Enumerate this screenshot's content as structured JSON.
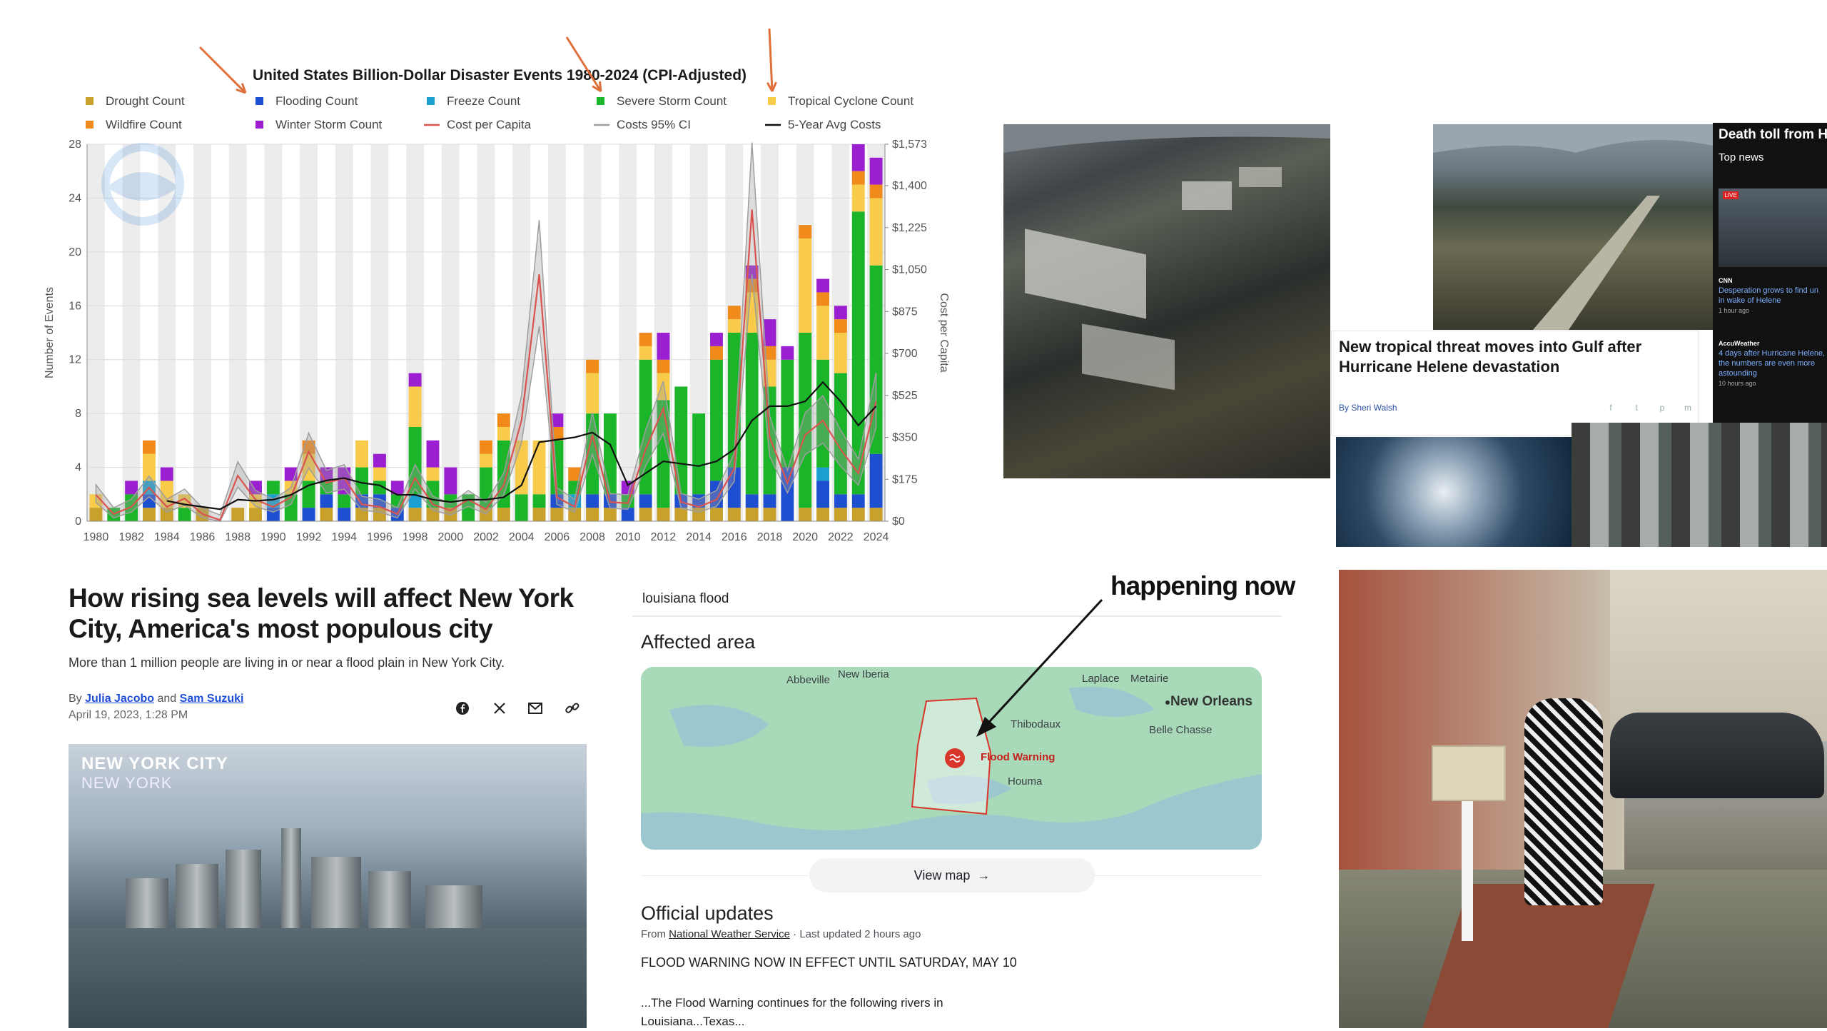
{
  "chart_data": {
    "type": "bar",
    "title": "United States Billion-Dollar Disaster Events 1980-2024 (CPI-Adjusted)",
    "ylabel": "Number of Events",
    "y2label": "Cost per Capita",
    "ylim": [
      0,
      28
    ],
    "y2lim": [
      0,
      1573
    ],
    "yticks": [
      "0",
      "4",
      "8",
      "12",
      "16",
      "20",
      "24",
      "28"
    ],
    "y2ticks": [
      "$0",
      "$175",
      "$350",
      "$525",
      "$700",
      "$875",
      "$1,050",
      "$1,225",
      "$1,400",
      "$1,573"
    ],
    "xticks": [
      "1980",
      "1982",
      "1984",
      "1986",
      "1988",
      "1990",
      "1992",
      "1994",
      "1996",
      "1998",
      "2000",
      "2002",
      "2004",
      "2006",
      "2008",
      "2010",
      "2012",
      "2014",
      "2016",
      "2018",
      "2020",
      "2022",
      "2024"
    ],
    "legend": [
      "Drought Count",
      "Flooding Count",
      "Freeze Count",
      "Severe Storm Count",
      "Tropical Cyclone Count",
      "Wildfire Count",
      "Winter Storm Count",
      "Cost per Capita",
      "Costs 95% CI",
      "5-Year Avg Costs"
    ],
    "grid": true,
    "x": [
      1980,
      1981,
      1982,
      1983,
      1984,
      1985,
      1986,
      1987,
      1988,
      1989,
      1990,
      1991,
      1992,
      1993,
      1994,
      1995,
      1996,
      1997,
      1998,
      1999,
      2000,
      2001,
      2002,
      2003,
      2004,
      2005,
      2006,
      2007,
      2008,
      2009,
      2010,
      2011,
      2012,
      2013,
      2014,
      2015,
      2016,
      2017,
      2018,
      2019,
      2020,
      2021,
      2022,
      2023,
      2024
    ],
    "series": [
      {
        "name": "Drought Count",
        "values": [
          1,
          0,
          0,
          1,
          1,
          0,
          1,
          0,
          1,
          1,
          0,
          0,
          0,
          1,
          0,
          1,
          1,
          0,
          1,
          1,
          1,
          0,
          1,
          1,
          0,
          1,
          1,
          1,
          1,
          1,
          0,
          1,
          1,
          1,
          1,
          1,
          1,
          1,
          1,
          0,
          1,
          1,
          1,
          1,
          1
        ]
      },
      {
        "name": "Flooding Count",
        "values": [
          0,
          0,
          0,
          1,
          0,
          0,
          0,
          0,
          0,
          0,
          1,
          0,
          1,
          1,
          1,
          1,
          1,
          1,
          0,
          0,
          0,
          0,
          0,
          0,
          0,
          0,
          1,
          0,
          1,
          1,
          1,
          1,
          0,
          1,
          1,
          2,
          3,
          1,
          1,
          4,
          0,
          2,
          1,
          1,
          4
        ]
      },
      {
        "name": "Freeze Count",
        "values": [
          0,
          0,
          0,
          1,
          0,
          0,
          0,
          0,
          0,
          0,
          1,
          0,
          0,
          0,
          0,
          0,
          0,
          0,
          1,
          0,
          0,
          0,
          0,
          0,
          0,
          0,
          0,
          1,
          0,
          0,
          0,
          0,
          0,
          0,
          0,
          0,
          0,
          0,
          0,
          0,
          0,
          1,
          0,
          0,
          0
        ]
      },
      {
        "name": "Severe Storm Count",
        "values": [
          0,
          1,
          2,
          0,
          0,
          1,
          0,
          0,
          0,
          0,
          1,
          2,
          2,
          1,
          1,
          2,
          1,
          1,
          5,
          2,
          1,
          2,
          3,
          5,
          2,
          1,
          4,
          1,
          6,
          6,
          1,
          10,
          8,
          8,
          6,
          9,
          10,
          12,
          8,
          8,
          13,
          8,
          9,
          21,
          14
        ]
      },
      {
        "name": "Tropical Cyclone Count",
        "values": [
          1,
          0,
          0,
          2,
          2,
          1,
          0,
          0,
          0,
          1,
          0,
          1,
          2,
          0,
          0,
          2,
          1,
          0,
          3,
          1,
          0,
          0,
          1,
          1,
          4,
          4,
          0,
          0,
          3,
          0,
          0,
          1,
          2,
          0,
          0,
          0,
          1,
          3,
          2,
          0,
          7,
          4,
          3,
          2,
          5
        ]
      },
      {
        "name": "Wildfire Count",
        "values": [
          0,
          0,
          0,
          1,
          0,
          0,
          0,
          0,
          0,
          0,
          0,
          0,
          1,
          0,
          0,
          0,
          0,
          0,
          0,
          0,
          0,
          0,
          1,
          1,
          0,
          0,
          1,
          1,
          1,
          0,
          0,
          1,
          1,
          0,
          0,
          1,
          1,
          1,
          1,
          0,
          1,
          1,
          1,
          1,
          1
        ]
      },
      {
        "name": "Winter Storm Count",
        "values": [
          0,
          0,
          1,
          0,
          1,
          0,
          0,
          0,
          0,
          1,
          0,
          1,
          0,
          1,
          2,
          0,
          1,
          1,
          1,
          2,
          2,
          0,
          0,
          0,
          0,
          0,
          1,
          0,
          0,
          0,
          1,
          0,
          2,
          0,
          0,
          1,
          0,
          1,
          2,
          1,
          0,
          1,
          1,
          2,
          2
        ]
      }
    ],
    "lines": [
      {
        "name": "Cost per Capita",
        "values": [
          110,
          30,
          60,
          140,
          60,
          95,
          30,
          5,
          190,
          90,
          60,
          100,
          290,
          160,
          180,
          70,
          60,
          30,
          180,
          70,
          45,
          90,
          50,
          150,
          420,
          1030,
          100,
          60,
          360,
          80,
          75,
          300,
          470,
          80,
          60,
          90,
          220,
          1300,
          350,
          160,
          360,
          420,
          300,
          200,
          500
        ]
      },
      {
        "name": "5-Year Avg Costs",
        "values": [
          null,
          null,
          null,
          null,
          85,
          70,
          60,
          50,
          90,
          85,
          90,
          110,
          150,
          170,
          180,
          160,
          150,
          110,
          110,
          90,
          80,
          90,
          90,
          100,
          150,
          330,
          340,
          350,
          370,
          320,
          150,
          200,
          250,
          240,
          230,
          250,
          300,
          420,
          480,
          480,
          500,
          580,
          500,
          400,
          480
        ]
      }
    ],
    "annotations": [
      "arrow-to-flooding-count",
      "arrow-to-severe-storm-count",
      "arrow-to-tropical-cyclone-count"
    ]
  },
  "news": {
    "headline": "New tropical threat moves into Gulf after Hurricane Helene devastation",
    "byline": "By Sheri Walsh",
    "share": [
      "f",
      "t",
      "p",
      "m"
    ],
    "sidebar_title": "Death toll from H",
    "sidebar_top": "Top news",
    "live_badge": "LIVE",
    "items": [
      {
        "source": "CNN",
        "text": "Desperation grows to find un in wake of Helene",
        "time": "1 hour ago"
      },
      {
        "source": "AccuWeather",
        "text": "4 days after Hurricane Helene, the numbers are even more astounding",
        "time": "10 hours ago"
      }
    ]
  },
  "article": {
    "headline": "How rising sea levels will affect New York City, America's most populous city",
    "subhead": "More than 1 million people are living in or near a flood plain in New York City.",
    "byline_prefix": "By",
    "author1": "Julia Jacobo",
    "byline_and": "and",
    "author2": "Sam Suzuki",
    "date": "April 19, 2023, 1:28 PM",
    "video_city": "NEW YORK CITY",
    "video_state": "NEW YORK"
  },
  "search": {
    "query": "louisiana flood",
    "affected_title": "Affected area",
    "map_labels": {
      "abbeville": "Abbeville",
      "new_iberia": "New Iberia",
      "laplace": "Laplace",
      "metairie": "Metairie",
      "new_orleans": "New Orleans",
      "thibodaux": "Thibodaux",
      "belle_chasse": "Belle Chasse",
      "houma": "Houma",
      "flood_warning": "Flood Warning"
    },
    "view_map": "View map",
    "official_title": "Official updates",
    "source_prefix": "From",
    "source": "National Weather Service",
    "updated": "· Last updated 2 hours ago",
    "warning": "FLOOD WARNING NOW IN EFFECT UNTIL SATURDAY, MAY 10",
    "rivers": "...The Flood Warning continues for the following rivers in Louisiana...Texas...",
    "annotation": "happening now"
  },
  "colors": {
    "drought": "#c8a02a",
    "flooding": "#1f4fd1",
    "freeze": "#1a9fd0",
    "severe_storm": "#1bb52a",
    "tropical": "#f8cb4a",
    "wildfire": "#f08a1a",
    "winter": "#9b1fd0",
    "cost_line": "#d9534f",
    "ci": "#9e9e9e",
    "avg": "#111111",
    "arrow": "#e0703a"
  }
}
